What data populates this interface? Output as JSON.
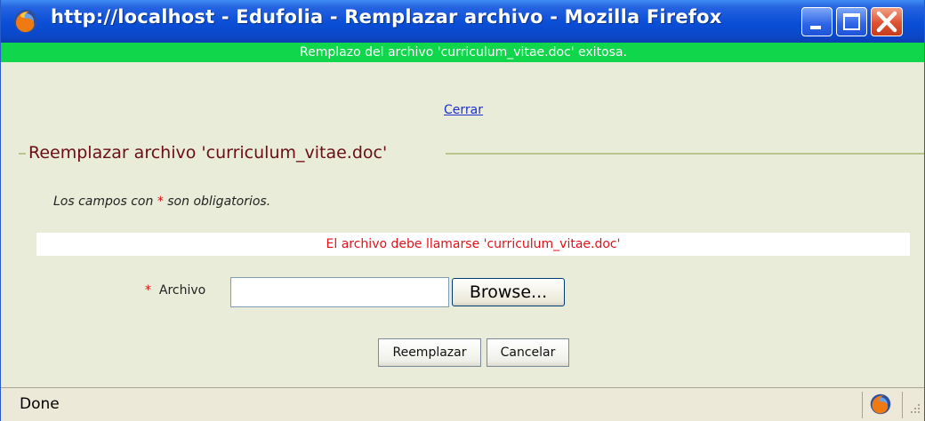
{
  "window": {
    "title": "http://localhost - Edufolia - Remplazar archivo - Mozilla Firefox",
    "controls": [
      "minimize-icon",
      "maximize-icon",
      "close-icon"
    ]
  },
  "banner": {
    "message": "Remplazo del archivo 'curriculum_vitae.doc' exitosa.",
    "color": "#0fd64a"
  },
  "close_link": "Cerrar",
  "form": {
    "legend": "Reemplazar archivo 'curriculum_vitae.doc'",
    "required_note_prefix": "Los campos con ",
    "required_star": "*",
    "required_note_suffix": " son obligatorios.",
    "warning": "El archivo debe llamarse 'curriculum_vitae.doc'",
    "file_field": {
      "star": "*",
      "label": "Archivo",
      "value": "",
      "browse_label": "Browse..."
    },
    "buttons": {
      "replace": "Reemplazar",
      "cancel": "Cancelar"
    }
  },
  "statusbar": {
    "text": "Done"
  },
  "colors": {
    "titlebar": "#0a4ed6",
    "page_bg": "#e8ecd8",
    "legend_text": "#6a0d16",
    "warning_text": "#e0121a",
    "link": "#1f2fd0"
  }
}
